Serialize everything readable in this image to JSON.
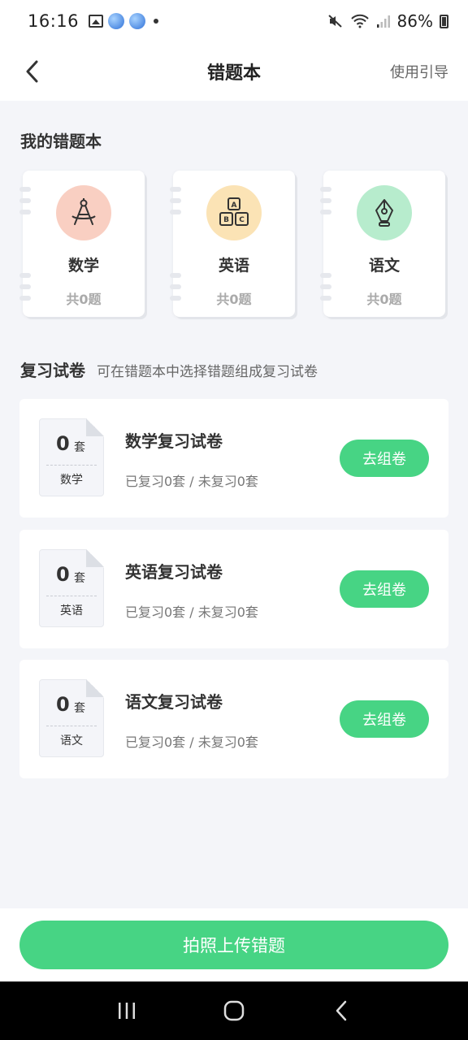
{
  "status_bar": {
    "time": "16:16",
    "battery": "86%"
  },
  "header": {
    "title": "错题本",
    "guide_label": "使用引导"
  },
  "my_notebooks": {
    "title": "我的错题本",
    "items": [
      {
        "name": "数学",
        "count": "共0题",
        "icon": "compass-icon",
        "color": "#f9cfc2"
      },
      {
        "name": "英语",
        "count": "共0题",
        "icon": "abc-blocks-icon",
        "color": "#fbe3b5"
      },
      {
        "name": "语文",
        "count": "共0题",
        "icon": "pen-nib-icon",
        "color": "#b7eccd"
      }
    ]
  },
  "review": {
    "title": "复习试卷",
    "subtitle": "可在错题本中选择错题组成复习试卷",
    "items": [
      {
        "count": "0",
        "unit": "套",
        "subject": "数学",
        "title": "数学复习试卷",
        "stats": "已复习0套 / 未复习0套",
        "button": "去组卷"
      },
      {
        "count": "0",
        "unit": "套",
        "subject": "英语",
        "title": "英语复习试卷",
        "stats": "已复习0套 / 未复习0套",
        "button": "去组卷"
      },
      {
        "count": "0",
        "unit": "套",
        "subject": "语文",
        "title": "语文复习试卷",
        "stats": "已复习0套 / 未复习0套",
        "button": "去组卷"
      }
    ]
  },
  "bottom": {
    "upload_label": "拍照上传错题"
  },
  "colors": {
    "accent": "#47d484",
    "background": "#f4f5f9"
  }
}
